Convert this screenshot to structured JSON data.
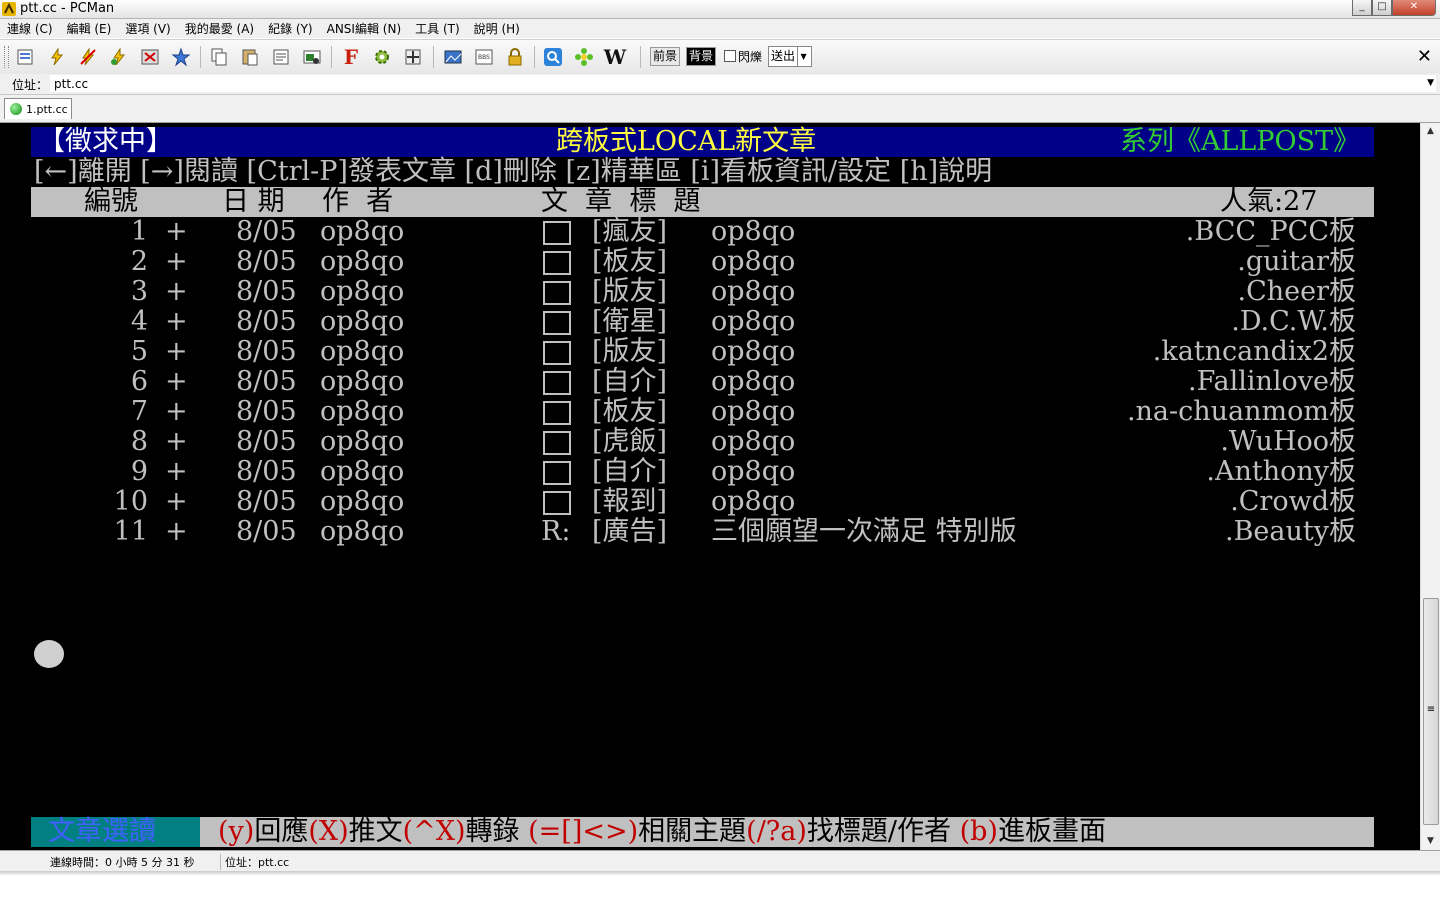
{
  "window": {
    "title": "ptt.cc - PCMan",
    "min": "_",
    "max": "□",
    "close": "✕"
  },
  "menu": [
    "連線 (C)",
    "編輯 (E)",
    "選項 (V)",
    "我的最愛 (A)",
    "紀錄 (Y)",
    "ANSI編輯 (N)",
    "工具 (T)",
    "說明 (H)"
  ],
  "toolbar": {
    "fg_label": "前景",
    "bg_label": "背景",
    "blink_label": "閃爍",
    "send_label": "送出",
    "icons": [
      "address-book-icon",
      "quick-connect-icon",
      "disconnect-icon",
      "reconnect-icon",
      "close-connection-icon",
      "add-favorite-icon",
      "copy-icon",
      "paste-icon",
      "copy-article-icon",
      "screenshot-icon",
      "font-icon",
      "settings-icon",
      "fullscreen-icon",
      "image-icon",
      "ascii-art-icon",
      "lock-icon",
      "search-icon",
      "flower-icon",
      "wikipedia-icon"
    ],
    "wiki_glyph": "W",
    "font_glyph": "F",
    "close": "✕"
  },
  "address": {
    "label": "位址：",
    "value": "ptt.cc",
    "drop": "▼"
  },
  "tabs": [
    {
      "label": "1.ptt.cc"
    }
  ],
  "terminal": {
    "header": {
      "left": "【徵求中】",
      "center": "跨板式LOCAL新文章",
      "right": "系列《ALLPOST》"
    },
    "help": "[←]離開 [→]閱讀 [Ctrl-P]發表文章 [d]刪除 [z]精華區 [i]看板資訊/設定 [h]說明",
    "columns": {
      "num": "編號",
      "date": "日 期",
      "author": "作  者",
      "title": "文  章  標  題",
      "popularity": "人氣:27"
    },
    "rows": [
      {
        "num": "1",
        "mark": "+",
        "date": "8/05",
        "author": "op8qo",
        "prefix": "",
        "category": "[瘋友]",
        "title": "op8qo",
        "board": ".BCC_PCC板"
      },
      {
        "num": "2",
        "mark": "+",
        "date": "8/05",
        "author": "op8qo",
        "prefix": "",
        "category": "[板友]",
        "title": "op8qo",
        "board": ".guitar板"
      },
      {
        "num": "3",
        "mark": "+",
        "date": "8/05",
        "author": "op8qo",
        "prefix": "",
        "category": "[版友]",
        "title": "op8qo",
        "board": ".Cheer板"
      },
      {
        "num": "4",
        "mark": "+",
        "date": "8/05",
        "author": "op8qo",
        "prefix": "",
        "category": "[衛星]",
        "title": "op8qo",
        "board": ".D.C.W.板"
      },
      {
        "num": "5",
        "mark": "+",
        "date": "8/05",
        "author": "op8qo",
        "prefix": "",
        "category": "[版友]",
        "title": "op8qo",
        "board": ".katncandix2板"
      },
      {
        "num": "6",
        "mark": "+",
        "date": "8/05",
        "author": "op8qo",
        "prefix": "",
        "category": "[自介]",
        "title": "op8qo",
        "board": ".Fallinlove板"
      },
      {
        "num": "7",
        "mark": "+",
        "date": "8/05",
        "author": "op8qo",
        "prefix": "",
        "category": "[板友]",
        "title": "op8qo",
        "board": ".na-chuanmom板"
      },
      {
        "num": "8",
        "mark": "+",
        "date": "8/05",
        "author": "op8qo",
        "prefix": "",
        "category": "[虎飯]",
        "title": "op8qo",
        "board": ".WuHoo板"
      },
      {
        "num": "9",
        "mark": "+",
        "date": "8/05",
        "author": "op8qo",
        "prefix": "",
        "category": "[自介]",
        "title": "op8qo",
        "board": ".Anthony板"
      },
      {
        "num": "10",
        "mark": "+",
        "date": "8/05",
        "author": "op8qo",
        "prefix": "",
        "category": "[報到]",
        "title": "op8qo",
        "board": ".Crowd板"
      },
      {
        "num": "11",
        "mark": "+",
        "date": "8/05",
        "author": "op8qo",
        "prefix": "R:",
        "category": "[廣告]",
        "title": "三個願望一次滿足 特別版",
        "board": ".Beauty板"
      }
    ],
    "footer": {
      "mode": "文章選讀",
      "y_key": "(y)",
      "y_text": "回應",
      "x_key": "(X)",
      "x_text": "推文",
      "cx_key": "(^X)",
      "cx_text": "轉錄",
      "rel_key": "(=[]<>)",
      "rel_text": "相關主題",
      "find_key": "(/?a)",
      "find_text": "找標題/作者",
      "b_key": "(b)",
      "b_text": "進板畫面"
    }
  },
  "status": {
    "connection_time": "連線時間：0 小時 5 分 31 秒",
    "address": "位址：ptt.cc"
  },
  "colors": {
    "terminal_bg": "#000000",
    "header_bg": "#000088",
    "column_bg": "#c0c0c0",
    "footer_mode_bg": "#008080"
  }
}
